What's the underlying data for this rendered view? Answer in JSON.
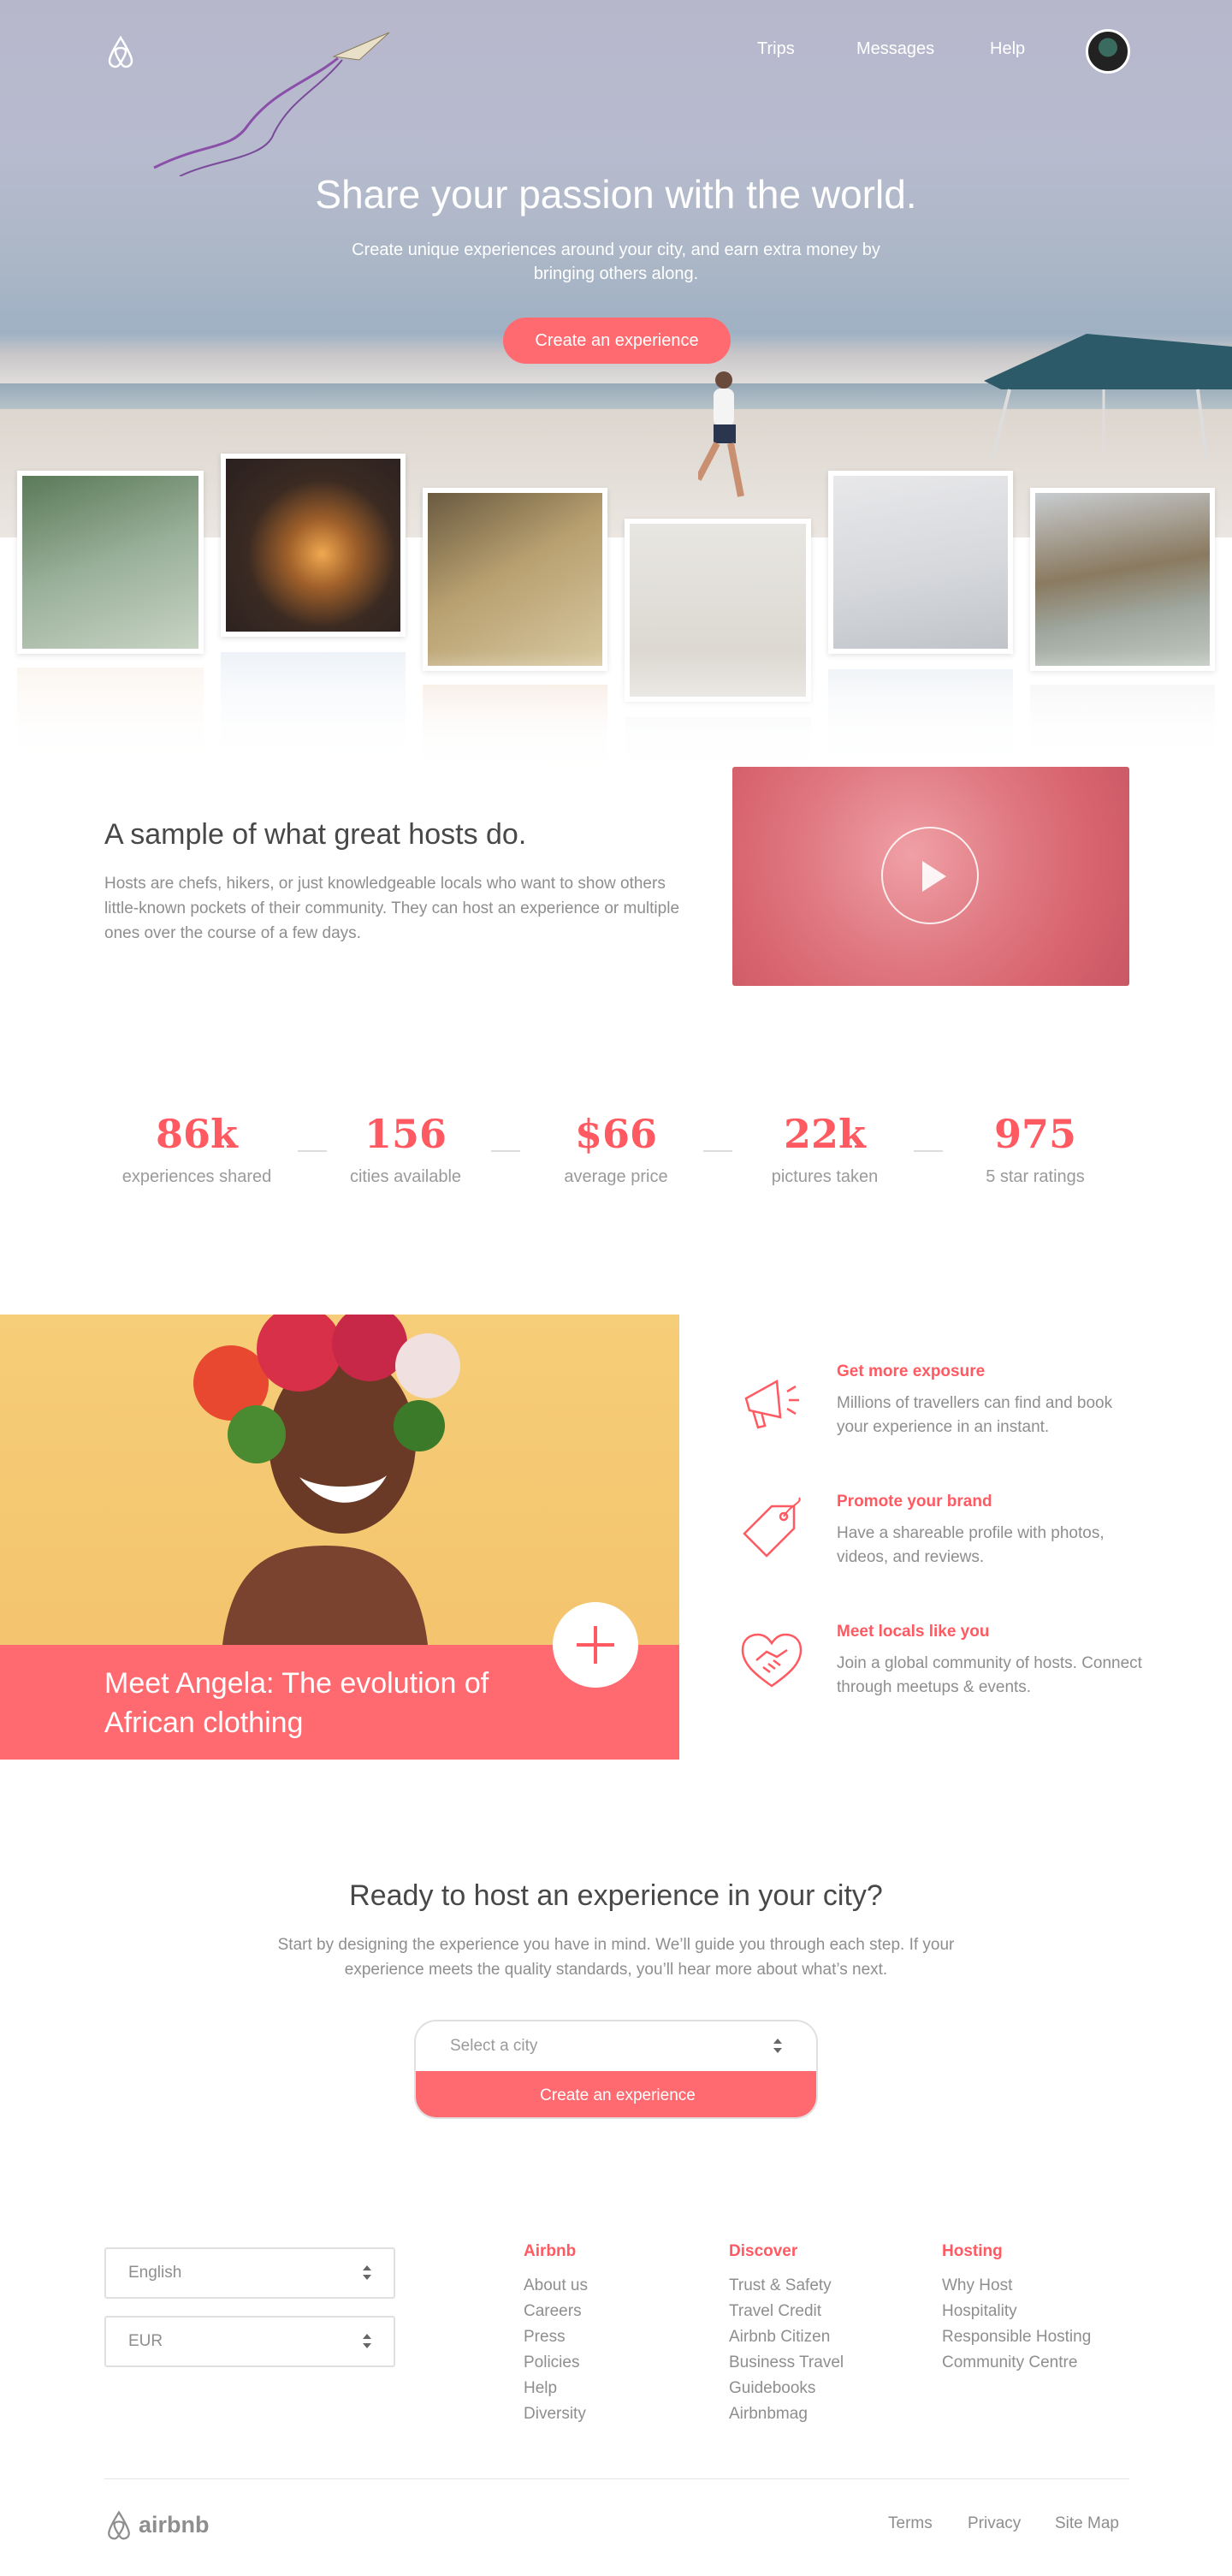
{
  "header": {
    "nav": [
      "Trips",
      "Messages",
      "Help"
    ]
  },
  "hero": {
    "title": "Share your passion with the world.",
    "subtitle": "Create unique experiences around your city, and earn extra money by bringing others along.",
    "cta": "Create an experience"
  },
  "sample": {
    "title": "A sample of what great hosts do.",
    "text": "Hosts are chefs, hikers, or just knowledgeable locals who want to show others little-known pockets of their community. They can host an experience or multiple ones over the course of a few days."
  },
  "stats": [
    {
      "value": "86k",
      "label": "experiences shared"
    },
    {
      "value": "156",
      "label": "cities available"
    },
    {
      "value": "$66",
      "label": "average price"
    },
    {
      "value": "22k",
      "label": "pictures taken"
    },
    {
      "value": "975",
      "label": "5 star ratings"
    }
  ],
  "story": {
    "title": "Meet Angela: The evolution of African clothing"
  },
  "features": [
    {
      "icon": "megaphone-icon",
      "title": "Get more exposure",
      "text": "Millions of travellers can find and book your experience in an instant."
    },
    {
      "icon": "tag-icon",
      "title": "Promote your brand",
      "text": "Have a shareable profile with photos, videos, and reviews."
    },
    {
      "icon": "handshake-icon",
      "title": "Meet locals like you",
      "text": "Join a global community of hosts. Connect through meetups & events."
    }
  ],
  "cta": {
    "title": "Ready to host an experience in your city?",
    "text": "Start by designing the experience you have in mind. We’ll guide you through each step. If your experience meets the quality standards, you’ll hear more about what’s next.",
    "select_placeholder": "Select a city",
    "button": "Create an experience"
  },
  "footer": {
    "language": "English",
    "currency": "EUR",
    "columns": [
      {
        "title": "Airbnb",
        "links": [
          "About us",
          "Careers",
          "Press",
          "Policies",
          "Help",
          "Diversity"
        ]
      },
      {
        "title": "Discover",
        "links": [
          "Trust & Safety",
          "Travel Credit",
          "Airbnb Citizen",
          "Business Travel",
          "Guidebooks",
          "Airbnbmag"
        ]
      },
      {
        "title": "Hosting",
        "links": [
          "Why Host",
          "Hospitality",
          "Responsible Hosting",
          "Community Centre"
        ]
      }
    ],
    "brand": "airbnb",
    "bottom_links": [
      "Terms",
      "Privacy",
      "Site Map"
    ]
  },
  "colors": {
    "accent": "#ff5a62",
    "button": "#ff6a70"
  }
}
